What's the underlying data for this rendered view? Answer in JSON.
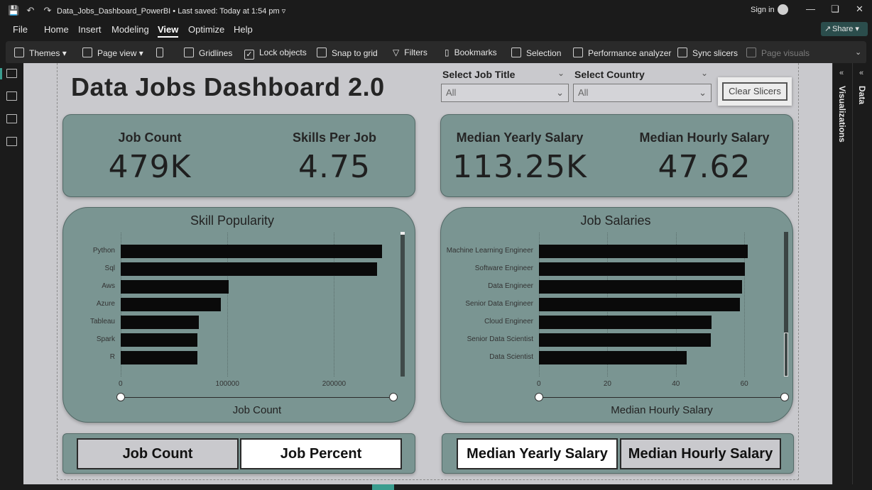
{
  "titlebar": {
    "document": "Data_Jobs_Dashboard_PowerBI",
    "saved": "Last saved: Today at 1:54 pm",
    "sign_in": "Sign in"
  },
  "menu": {
    "items": [
      "File",
      "Home",
      "Insert",
      "Modeling",
      "View",
      "Optimize",
      "Help"
    ],
    "active": "View",
    "share": "Share"
  },
  "ribbon": {
    "themes": "Themes",
    "page_view": "Page view",
    "gridlines": "Gridlines",
    "lock_objects": "Lock objects",
    "snap_to_grid": "Snap to grid",
    "filters": "Filters",
    "bookmarks": "Bookmarks",
    "selection": "Selection",
    "performance_analyzer": "Performance analyzer",
    "sync_slicers": "Sync slicers",
    "page_visuals": "Page visuals"
  },
  "dashboard": {
    "title": "Data Jobs Dashboard 2.0",
    "slicers": {
      "job_title": {
        "label": "Select Job Title",
        "value": "All"
      },
      "country": {
        "label": "Select Country",
        "value": "All"
      },
      "clear": "Clear Slicers"
    },
    "kpis": {
      "job_count": {
        "label": "Job Count",
        "value": "479K"
      },
      "skills_per_job": {
        "label": "Skills Per Job",
        "value": "4.75"
      },
      "median_yearly": {
        "label": "Median Yearly Salary",
        "value": "113.25K"
      },
      "median_hourly": {
        "label": "Median Hourly Salary",
        "value": "47.62"
      }
    },
    "toggles": {
      "job_count": "Job Count",
      "job_percent": "Job Percent",
      "median_yearly": "Median Yearly Salary",
      "median_hourly": "Median Hourly Salary"
    }
  },
  "chart_data": [
    {
      "type": "bar",
      "orientation": "horizontal",
      "title": "Skill Popularity",
      "xlabel": "Job Count",
      "ylabel": "",
      "categories": [
        "Python",
        "Sql",
        "Aws",
        "Azure",
        "Tableau",
        "Spark",
        "R"
      ],
      "values": [
        245000,
        240500,
        101000,
        94000,
        73500,
        72000,
        72000
      ],
      "xlim": [
        0,
        245000
      ],
      "xticks": [
        0,
        100000,
        200000
      ],
      "xtick_labels": [
        "0",
        "100000",
        "200000"
      ],
      "grid": true,
      "bar_color": "#0a0a0a"
    },
    {
      "type": "bar",
      "orientation": "horizontal",
      "title": "Job Salaries",
      "xlabel": "Median Hourly Salary",
      "ylabel": "",
      "categories": [
        "Machine Learning Engineer",
        "Software Engineer",
        "Data Engineer",
        "Senior Data Engineer",
        "Cloud Engineer",
        "Senior Data Scientist",
        "Data Scientist"
      ],
      "values": [
        61,
        60.2,
        59.4,
        58.8,
        50.5,
        50.3,
        43.2
      ],
      "xlim": [
        0,
        61
      ],
      "xticks": [
        0,
        20,
        40,
        60
      ],
      "xtick_labels": [
        "0",
        "20",
        "40",
        "60"
      ],
      "grid": true,
      "bar_color": "#0a0a0a"
    }
  ],
  "colors": {
    "card": "#7a9592",
    "canvas": "#c9c9cd",
    "accent": "#3a9d8f"
  },
  "panes": {
    "visualizations": "Visualizations",
    "data": "Data"
  }
}
